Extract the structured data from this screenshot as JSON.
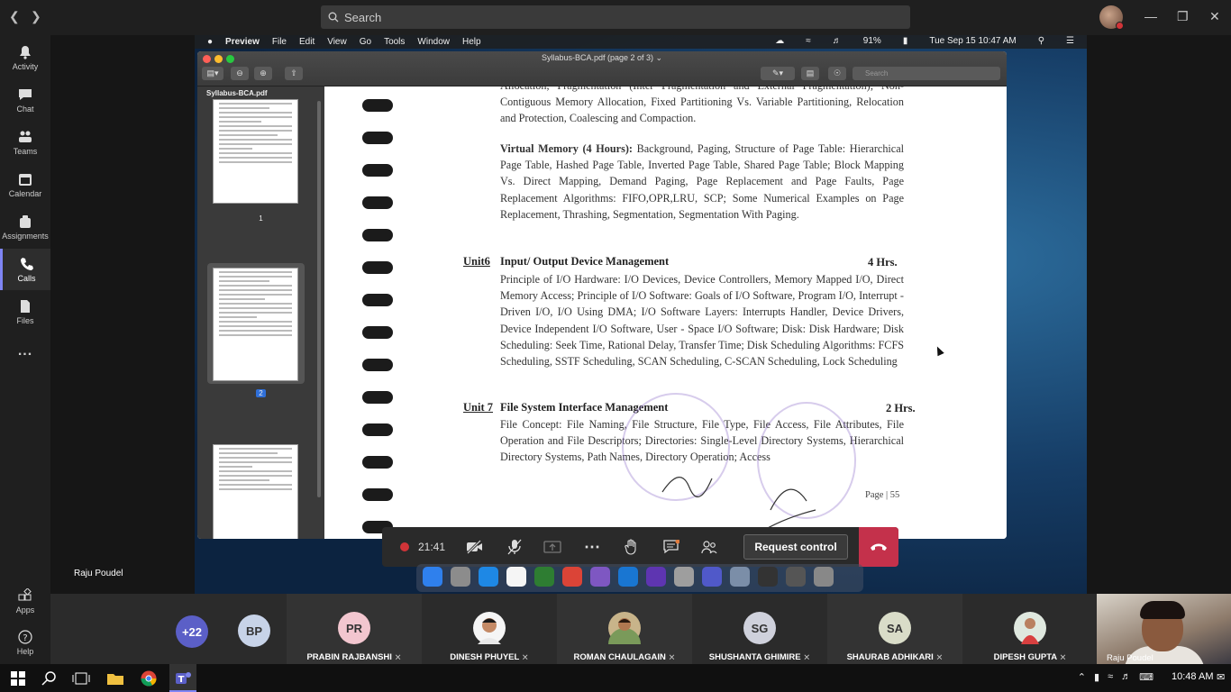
{
  "teams": {
    "search_placeholder": "Search",
    "rail": [
      {
        "label": "Activity",
        "icon": "bell-icon"
      },
      {
        "label": "Chat",
        "icon": "chat-icon"
      },
      {
        "label": "Teams",
        "icon": "teams-icon"
      },
      {
        "label": "Calendar",
        "icon": "calendar-icon"
      },
      {
        "label": "Assignments",
        "icon": "assignments-icon"
      },
      {
        "label": "Calls",
        "icon": "phone-icon",
        "active": true
      },
      {
        "label": "Files",
        "icon": "files-icon"
      },
      {
        "label": "...",
        "icon": "more-icon"
      }
    ],
    "rail_bottom": [
      {
        "label": "Apps",
        "icon": "apps-icon"
      },
      {
        "label": "Help",
        "icon": "help-icon"
      }
    ]
  },
  "mac": {
    "menu": [
      "Preview",
      "File",
      "Edit",
      "View",
      "Go",
      "Tools",
      "Window",
      "Help"
    ],
    "status": {
      "battery": "91%",
      "datetime": "Tue Sep 15  10:47 AM"
    }
  },
  "preview": {
    "window_title": "Syllabus-BCA.pdf (page 2 of 3) ⌄",
    "search_placeholder": "Search",
    "sidebar_title": "Syllabus-BCA.pdf",
    "thumb_labels": [
      "1",
      "2"
    ]
  },
  "document": {
    "top_text": "Allocation, Fragmentation (Inter Fragmentation and External Fragmentation); Non-Contiguous Memory Allocation, Fixed Partitioning Vs. Variable Partitioning, Relocation and Protection, Coalescing and Compaction.",
    "vm_heading": "Virtual Memory (4 Hours):",
    "vm_text": "Background, Paging, Structure of Page Table: Hierarchical Page Table, Hashed Page Table, Inverted Page Table, Shared Page Table; Block Mapping Vs. Direct Mapping, Demand Paging, Page Replacement and Page Faults, Page Replacement Algorithms: FIFO,OPR,LRU, SCP; Some Numerical Examples on Page Replacement, Thrashing, Segmentation, Segmentation With Paging.",
    "unit6_label": "Unit6",
    "unit6_title": "Input/ Output Device Management",
    "unit6_hrs": "4 Hrs.",
    "unit6_text": "Principle of I/O Hardware: I/O Devices, Device Controllers, Memory Mapped I/O, Direct Memory Access; Principle of I/O Software: Goals of I/O Software, Program I/O, Interrupt -Driven I/O, I/O Using DMA; I/O Software Layers: Interrupts Handler, Device Drivers, Device Independent I/O Software, User - Space I/O Software; Disk: Disk Hardware; Disk Scheduling: Seek Time, Rational Delay, Transfer Time; Disk Scheduling Algorithms: FCFS Scheduling, SSTF Scheduling, SCAN Scheduling, C-SCAN Scheduling, Lock Scheduling",
    "unit7_label": "Unit 7",
    "unit7_title": "File System Interface Management",
    "unit7_hrs": "2 Hrs.",
    "unit7_text": "File Concept: File Naming, File Structure, File Type, File Access, File Attributes, File Operation and File Descriptors; Directories: Single-Level Directory Systems, Hierarchical Directory Systems, Path Names, Directory Operation; Access",
    "page_footer": "Page | 55"
  },
  "call": {
    "timer": "21:41",
    "request_control": "Request control",
    "presenter_name": "Raju Poudel",
    "overflow_count": "+22",
    "participants": [
      {
        "initials": "BP",
        "name": "",
        "color": "#c7d3e8"
      },
      {
        "initials": "PR",
        "name": "PRABIN RAJBANSHI",
        "color": "#f2c6cf"
      },
      {
        "initials": "",
        "name": "DINESH PHUYEL",
        "color": "#ffffff",
        "photo": true
      },
      {
        "initials": "",
        "name": "ROMAN CHAULAGAIN",
        "color": "#c8b48a",
        "photo": true
      },
      {
        "initials": "SG",
        "name": "SHUSHANTA GHIMIRE",
        "color": "#cfd1dc"
      },
      {
        "initials": "SA",
        "name": "SHAURAB ADHIKARI",
        "color": "#d9dcc8"
      },
      {
        "initials": "",
        "name": "DIPESH GUPTA",
        "color": "#dfe8df",
        "photo": true
      }
    ],
    "self_name": "Raju Poudel"
  },
  "taskbar": {
    "time": "10:48 AM"
  },
  "colors": {
    "teams_accent": "#7f85f5",
    "hangup": "#c4314b",
    "record": "#d13438"
  }
}
